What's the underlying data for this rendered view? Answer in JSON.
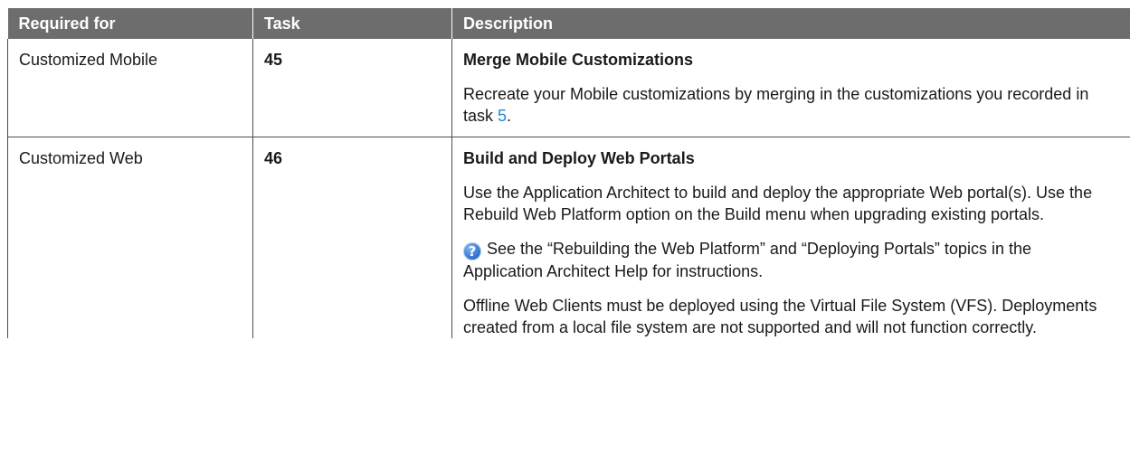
{
  "table": {
    "headers": {
      "required_for": "Required for",
      "task": "Task",
      "description": "Description"
    },
    "rows": [
      {
        "required_for": "Customized Mobile",
        "task": "45",
        "title": "Merge Mobile Customizations",
        "para1_text": "Recreate your Mobile customizations by merging in the customizations you recorded in task ",
        "para1_link": "5",
        "para1_end": "."
      },
      {
        "required_for": "Customized Web",
        "task": "46",
        "title": "Build and Deploy Web Portals",
        "para1": "Use the Application Architect to build and deploy the appropriate Web portal(s). Use the Rebuild Web Platform option on the Build menu when upgrading existing portals.",
        "help_icon": "help-question-icon",
        "help_glyph": "?",
        "para2": "See the “Rebuilding the Web Platform” and “Deploying Portals” topics in the Application Architect Help for instructions.",
        "para3": "Offline Web Clients must be deployed using the Virtual File System (VFS). Deployments created from a local file system are not supported and will not function correctly."
      }
    ]
  },
  "colors": {
    "header_bg": "#6d6d6d",
    "link": "#1f8bd2",
    "border": "#4d4d4d"
  }
}
